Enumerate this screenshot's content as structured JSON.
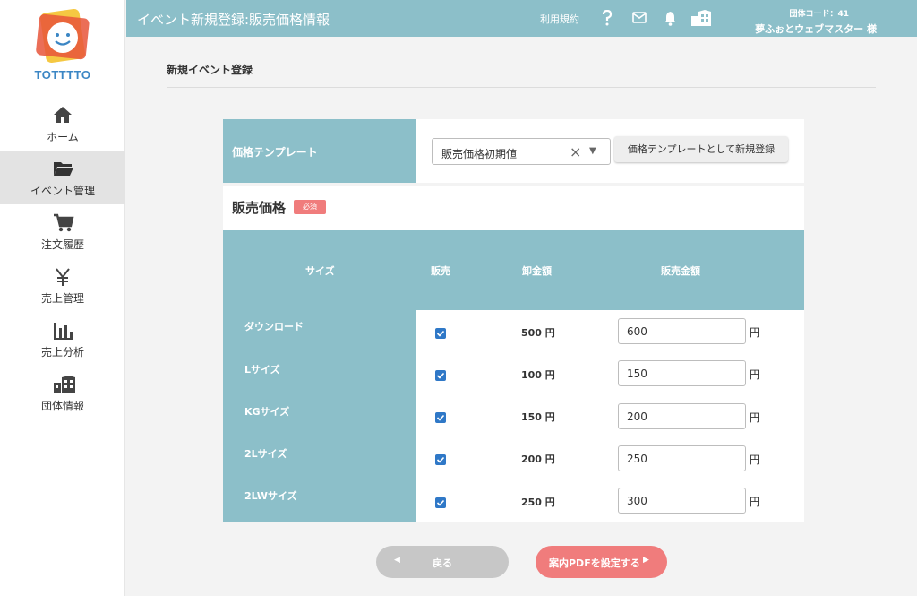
{
  "brand": {
    "logo_text": "TOTTTTO",
    "accent": "#8cbfc9",
    "pink": "#f07c7c",
    "blue": "#2f78c7"
  },
  "sidebar": {
    "items": [
      {
        "label": "ホーム",
        "icon": "home-icon"
      },
      {
        "label": "イベント管理",
        "icon": "folder-icon",
        "active": true
      },
      {
        "label": "注文履歴",
        "icon": "cart-icon"
      },
      {
        "label": "売上管理",
        "icon": "yen-icon"
      },
      {
        "label": "売上分析",
        "icon": "bar-chart-icon"
      },
      {
        "label": "団体情報",
        "icon": "building-icon"
      }
    ]
  },
  "header": {
    "title": "イベント新規登録:販売価格情報",
    "terms_link": "利用規約",
    "org_code": "団体コード：41",
    "user": "夢ふぉとウェブマスター 様"
  },
  "main": {
    "page_title": "新規イベント登録",
    "template": {
      "label": "価格テンプレート",
      "selected": "販売価格初期値",
      "register_button": "価格テンプレートとして新規登録"
    },
    "price": {
      "heading": "販売価格",
      "required_badge": "必須",
      "columns": {
        "size": "サイズ",
        "sale": "販売",
        "wholesale": "卸金額",
        "price": "販売金額"
      },
      "unit": "円",
      "rows": [
        {
          "size": "ダウンロード",
          "checked": true,
          "wholesale": "500 円",
          "price": "600"
        },
        {
          "size": "Lサイズ",
          "checked": true,
          "wholesale": "100 円",
          "price": "150"
        },
        {
          "size": "KGサイズ",
          "checked": true,
          "wholesale": "150 円",
          "price": "200"
        },
        {
          "size": "2Lサイズ",
          "checked": true,
          "wholesale": "200 円",
          "price": "250"
        },
        {
          "size": "2LWサイズ",
          "checked": true,
          "wholesale": "250 円",
          "price": "300"
        }
      ]
    },
    "buttons": {
      "back": "戻る",
      "next": "案内PDFを設定する"
    }
  }
}
